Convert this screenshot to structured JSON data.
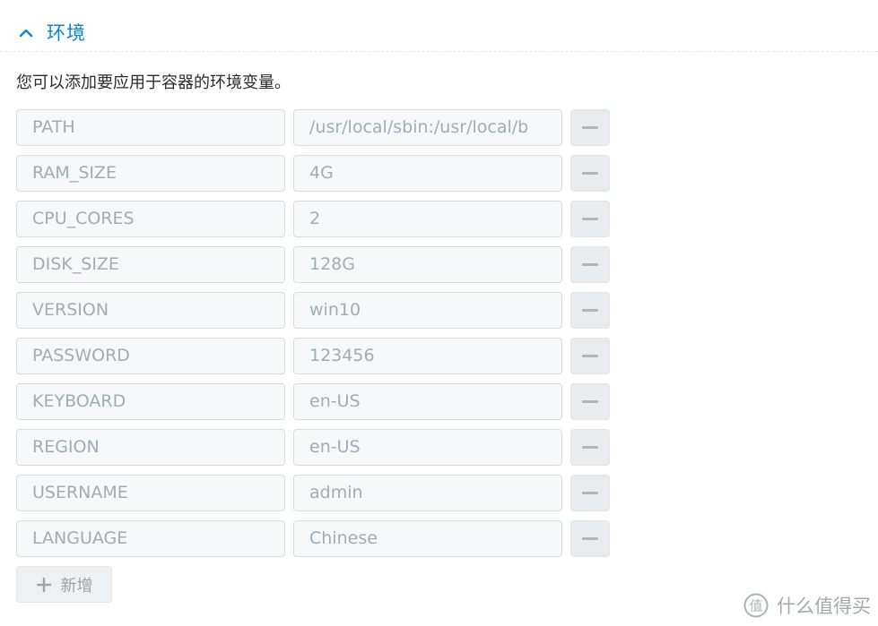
{
  "section": {
    "title": "环境",
    "description": "您可以添加要应用于容器的环境变量。",
    "toggle_icon": "chevron-up-icon"
  },
  "colors": {
    "accent": "#0b86c8",
    "field_bg": "#f6f8f9",
    "field_border": "#d7dde3",
    "field_text": "#a3abb3",
    "button_bg": "#e8ecef"
  },
  "env_vars": [
    {
      "key": "PATH",
      "value": "/usr/local/sbin:/usr/local/b"
    },
    {
      "key": "RAM_SIZE",
      "value": "4G"
    },
    {
      "key": "CPU_CORES",
      "value": "2"
    },
    {
      "key": "DISK_SIZE",
      "value": "128G"
    },
    {
      "key": "VERSION",
      "value": "win10"
    },
    {
      "key": "PASSWORD",
      "value": "123456"
    },
    {
      "key": "KEYBOARD",
      "value": "en-US"
    },
    {
      "key": "REGION",
      "value": "en-US"
    },
    {
      "key": "USERNAME",
      "value": "admin"
    },
    {
      "key": "LANGUAGE",
      "value": "Chinese"
    }
  ],
  "actions": {
    "add_label": "新增",
    "add_icon": "plus-icon",
    "remove_icon": "minus-icon"
  },
  "watermark": {
    "text": "什么值得买"
  }
}
